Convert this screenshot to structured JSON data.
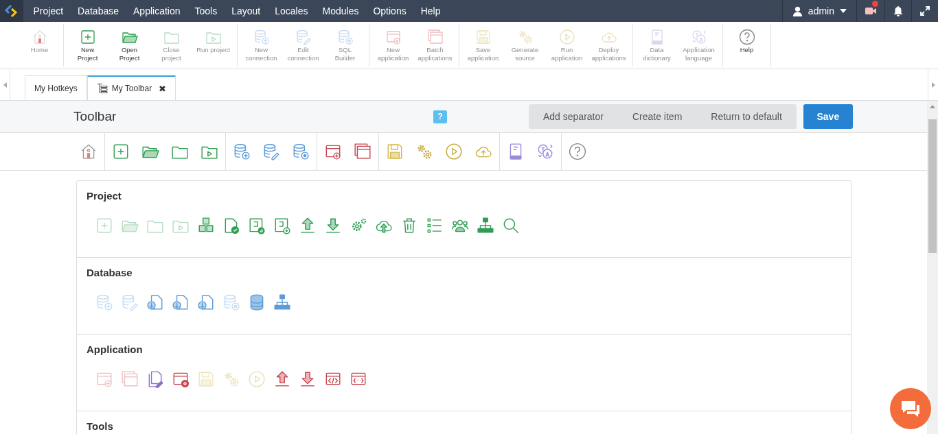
{
  "menu": [
    "Project",
    "Database",
    "Application",
    "Tools",
    "Layout",
    "Locales",
    "Modules",
    "Options",
    "Help"
  ],
  "user": {
    "name": "admin"
  },
  "notifications": {
    "video_alert": true
  },
  "toolbar": [
    {
      "kind": "home",
      "items": [
        {
          "label": "Home",
          "kind": "home",
          "disabled": true
        }
      ]
    },
    {
      "kind": "project",
      "items": [
        {
          "label": "New Project",
          "kind": "addbox",
          "disabled": false
        },
        {
          "label": "Open Project",
          "kind": "openfolder",
          "disabled": false
        },
        {
          "label": "Close project",
          "kind": "folder",
          "disabled": true
        },
        {
          "label": "Run project",
          "kind": "playfolder",
          "disabled": true
        }
      ]
    },
    {
      "kind": "database",
      "items": [
        {
          "label": "New connection",
          "kind": "dbadd",
          "disabled": true
        },
        {
          "label": "Edit connection",
          "kind": "dbedit",
          "disabled": true
        },
        {
          "label": "SQL Builder",
          "kind": "dbstar",
          "disabled": true
        }
      ]
    },
    {
      "kind": "application",
      "items": [
        {
          "label": "New application",
          "kind": "winadd",
          "disabled": true
        },
        {
          "label": "Batch applications",
          "kind": "windows",
          "disabled": true
        }
      ]
    },
    {
      "kind": "application",
      "items": [
        {
          "label": "Save application",
          "kind": "floppy",
          "disabled": true
        },
        {
          "label": "Generate source",
          "kind": "gears",
          "disabled": true
        },
        {
          "label": "Run application",
          "kind": "play",
          "disabled": true
        },
        {
          "label": "Deploy applications",
          "kind": "cloud",
          "disabled": true
        }
      ]
    },
    {
      "kind": "dictionary",
      "items": [
        {
          "label": "Data dictionary",
          "kind": "book",
          "disabled": true
        },
        {
          "label": "Application language",
          "kind": "translate",
          "disabled": true
        }
      ]
    },
    {
      "kind": "help",
      "items": [
        {
          "label": "Help",
          "kind": "help",
          "disabled": false
        }
      ]
    }
  ],
  "tabs": [
    {
      "label": "My Hotkeys",
      "selected": false
    },
    {
      "label": "My Toolbar",
      "selected": true,
      "close": "✖"
    }
  ],
  "page": {
    "title": "Toolbar",
    "help": "?",
    "actions": [
      "Add separator",
      "Create item",
      "Return to default"
    ],
    "save": "Save"
  },
  "preview": [
    {
      "kind": "home",
      "icons": [
        {
          "kind": "home"
        }
      ]
    },
    {
      "kind": "project",
      "icons": [
        {
          "kind": "addbox"
        },
        {
          "kind": "openfolder"
        },
        {
          "kind": "folder"
        },
        {
          "kind": "playfolder"
        }
      ]
    },
    {
      "kind": "database",
      "icons": [
        {
          "kind": "dbadd"
        },
        {
          "kind": "dbedit"
        },
        {
          "kind": "dbstar"
        }
      ]
    },
    {
      "kind": "application",
      "icons": [
        {
          "kind": "winadd"
        },
        {
          "kind": "windows"
        }
      ]
    },
    {
      "kind": "application",
      "icons": [
        {
          "kind": "floppy"
        },
        {
          "kind": "gears"
        },
        {
          "kind": "play"
        },
        {
          "kind": "cloud"
        }
      ]
    },
    {
      "kind": "dictionary",
      "icons": [
        {
          "kind": "book"
        },
        {
          "kind": "translate"
        }
      ]
    },
    {
      "kind": "help",
      "icons": [
        {
          "kind": "help"
        }
      ]
    }
  ],
  "sections": [
    {
      "title": "Project",
      "kind": "project",
      "icons": [
        {
          "kind": "addbox",
          "disabled": true
        },
        {
          "kind": "openfolder",
          "disabled": true
        },
        {
          "kind": "folder",
          "disabled": true
        },
        {
          "kind": "playfolder",
          "disabled": true
        },
        {
          "kind": "cubes",
          "disabled": false
        },
        {
          "kind": "doccheck",
          "disabled": false
        },
        {
          "kind": "docrefresh",
          "disabled": false
        },
        {
          "kind": "docadd",
          "disabled": false
        },
        {
          "kind": "upload",
          "disabled": false
        },
        {
          "kind": "download",
          "disabled": false
        },
        {
          "kind": "gear",
          "disabled": false
        },
        {
          "kind": "cloudup",
          "disabled": false
        },
        {
          "kind": "trash",
          "disabled": false
        },
        {
          "kind": "list",
          "disabled": false
        },
        {
          "kind": "people",
          "disabled": false
        },
        {
          "kind": "tree",
          "disabled": false
        },
        {
          "kind": "search",
          "disabled": false
        }
      ]
    },
    {
      "title": "Database",
      "kind": "database",
      "icons": [
        {
          "kind": "dbadd",
          "disabled": true
        },
        {
          "kind": "dbedit",
          "disabled": true
        },
        {
          "kind": "docimport",
          "disabled": false
        },
        {
          "kind": "docimport",
          "disabled": false
        },
        {
          "kind": "docimport",
          "disabled": false
        },
        {
          "kind": "dbstar",
          "disabled": true
        },
        {
          "kind": "database",
          "disabled": false
        },
        {
          "kind": "tree",
          "disabled": false
        }
      ]
    },
    {
      "title": "Application",
      "kind": "application",
      "icons": [
        {
          "kind": "winadd",
          "disabled": true
        },
        {
          "kind": "windows",
          "disabled": true
        },
        {
          "kind": "docedit",
          "disabled": false
        },
        {
          "kind": "wingear",
          "disabled": false
        },
        {
          "kind": "floppy",
          "disabled": true
        },
        {
          "kind": "gears",
          "disabled": true
        },
        {
          "kind": "play",
          "disabled": true
        },
        {
          "kind": "upload",
          "disabled": false
        },
        {
          "kind": "download",
          "disabled": false
        },
        {
          "kind": "codewin",
          "disabled": false
        },
        {
          "kind": "bracewin",
          "disabled": false
        }
      ]
    },
    {
      "title": "Tools"
    }
  ]
}
